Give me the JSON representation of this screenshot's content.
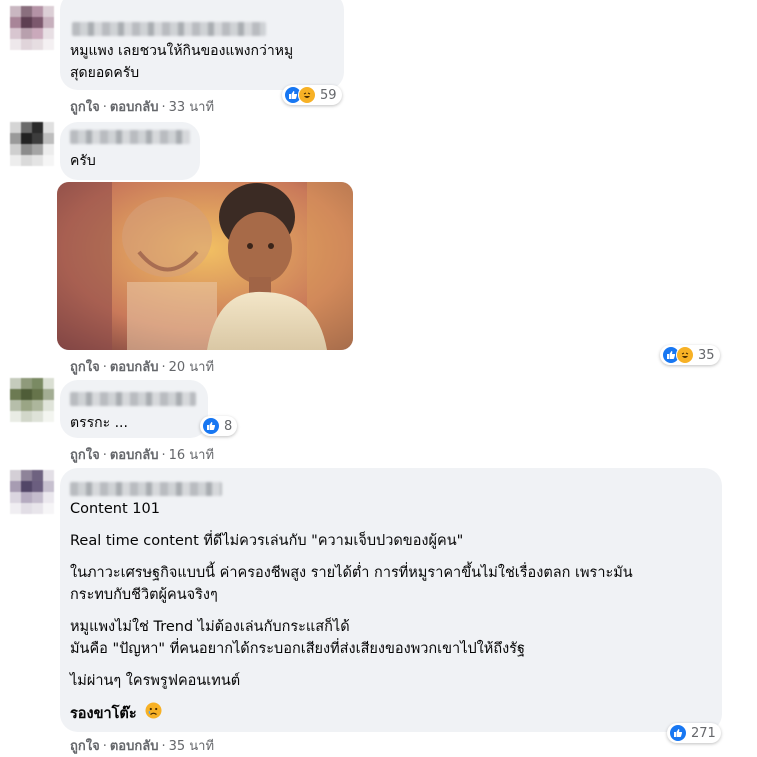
{
  "meta_labels": {
    "like": "ถูกใจ",
    "reply": "ตอบกลับ"
  },
  "comments": [
    {
      "lines": [
        "หมูแพง เลยชวนให้กินของแพงกว่าหมู",
        "สุดยอดครับ"
      ],
      "time": "33 นาที",
      "reactions": {
        "icons": [
          "like-icon",
          "haha-icon"
        ],
        "count": "59"
      }
    },
    {
      "lines": [
        "ครับ"
      ],
      "time": "20 นาที",
      "reactions": {
        "icons": [
          "like-icon",
          "haha-icon"
        ],
        "count": "35"
      }
    },
    {
      "lines": [
        "ตรรกะ ..."
      ],
      "time": "16 นาที",
      "reactions": {
        "icons": [
          "like-icon"
        ],
        "count": "8"
      }
    },
    {
      "lines": [
        "Content 101",
        "Real time content ที่ดีไม่ควรเล่นกับ \"ความเจ็บปวดของผู้คน\"",
        "ในภาวะเศรษฐกิจแบบนี้ ค่าครองชีพสูง รายได้ต่ำ การที่หมูราคาขึ้นไม่ใช่เรื่องตลก เพราะมัน",
        "กระทบกับชีวิตผู้คนจริงๆ",
        "หมูแพงไม่ใช่ Trend ไม่ต้องเล่นกับกระแสก็ได้",
        "มันคือ \"ปัญหา\" ที่คนอยากได้กระบอกเสียงที่ส่งเสียงของพวกเขาไปให้ถึงรัฐ",
        "ไม่ผ่านๆ ใครพรูฟคอนเทนต์",
        "รองขาโต๊ะ"
      ],
      "time": "35 นาที",
      "reactions": {
        "icons": [
          "like-icon"
        ],
        "count": "271"
      }
    }
  ],
  "colors": {
    "bubble": "#f0f2f5",
    "meta": "#65676b",
    "like": "#1877f2",
    "haha": "#f7b125"
  }
}
